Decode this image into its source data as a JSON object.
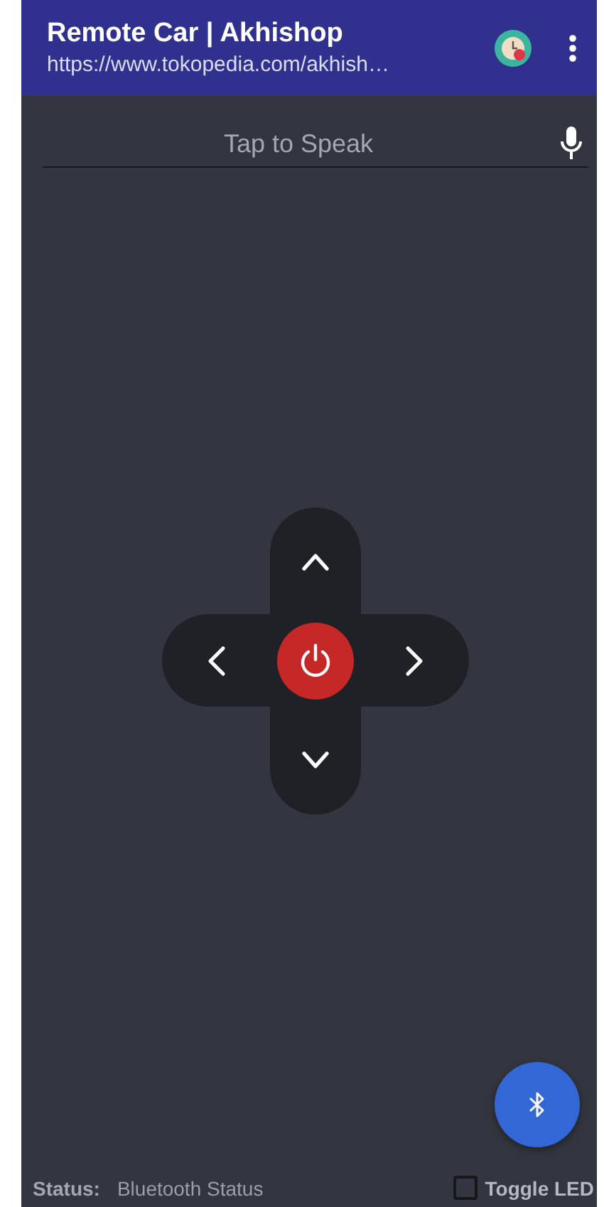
{
  "app_bar": {
    "title": "Remote Car | Akhishop",
    "subtitle": "https://www.tokopedia.com/akhish…"
  },
  "speech_field": {
    "placeholder": "Tap to Speak"
  },
  "status": {
    "label": "Status:",
    "value": "Bluetooth Status"
  },
  "toggle_led": {
    "label": "Toggle LED",
    "checked": false
  }
}
